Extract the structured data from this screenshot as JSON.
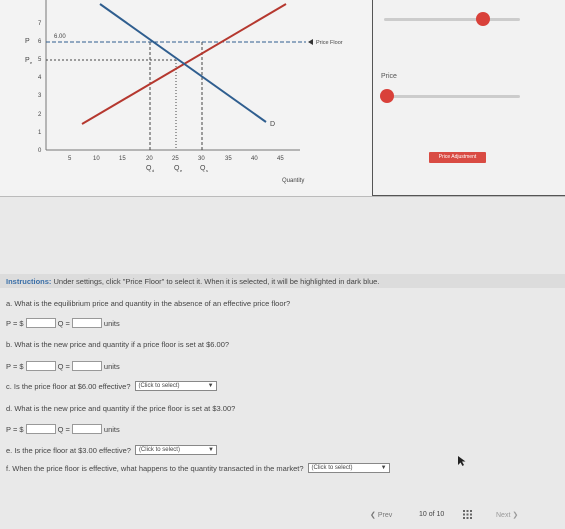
{
  "graph": {
    "y_ticks": [
      "7",
      "6",
      "5",
      "4",
      "3",
      "2",
      "1",
      "0"
    ],
    "x_ticks": [
      "5",
      "10",
      "15",
      "20",
      "25",
      "30",
      "35",
      "40",
      "45"
    ],
    "price_label": "P",
    "pe_label": "P",
    "pe_sub": "e",
    "price_value_label": "6.00",
    "price_floor_label": "Price Floor",
    "demand_label": "D",
    "x_axis_title": "Quantity",
    "qd_label": "Q",
    "qd_sub": "d",
    "qe_label": "Q",
    "qe_sub": "e",
    "qs_label": "Q",
    "qs_sub": "s",
    "colors": {
      "supply": "#b5382f",
      "demand": "#2f5e8f",
      "floor": "#2f5e8f"
    }
  },
  "panel": {
    "price_label": "Price",
    "adjust_button": "Price Adjustment"
  },
  "instructions": {
    "prefix": "Instructions:",
    "text": " Under settings, click \"Price Floor\" to select it. When it is selected, it will be highlighted in dark blue."
  },
  "questions": {
    "a": "a. What is the equilibrium price and quantity in the absence of an effective price floor?",
    "b": "b. What is the new price and quantity if a price floor is set at $6.00?",
    "c": "c. Is the price floor at $6.00 effective?",
    "d": "d. What is the new price and quantity if the price floor is set at $3.00?",
    "e": "e. Is the price floor at $3.00 effective?",
    "f": "f. When the price floor is effective, what happens to the quantity transacted in the market?"
  },
  "answer_row": {
    "p_label": "P = $",
    "q_label": "Q =",
    "units": "units"
  },
  "select_placeholder": "(Click to select)",
  "footer": {
    "prev": "Prev",
    "page": "10 of 10",
    "next": "Next"
  }
}
